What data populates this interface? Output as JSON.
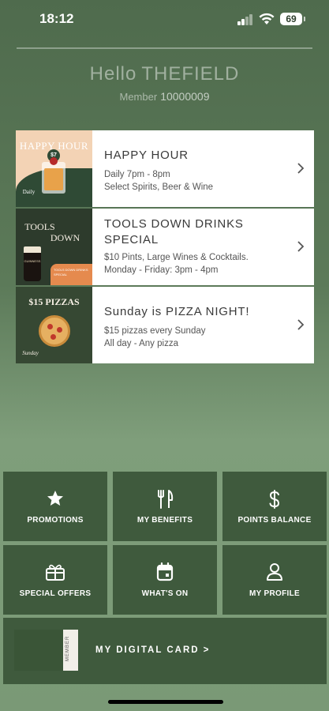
{
  "status_bar": {
    "time": "18:12",
    "battery": "69"
  },
  "header": {
    "greeting": "Hello",
    "user_name": "THEFIELD",
    "member_label": "Member",
    "member_number": "10000009"
  },
  "promotions": [
    {
      "title": "HAPPY HOUR",
      "lines": [
        "Daily 7pm - 8pm",
        "Select Spirits, Beer & Wine"
      ],
      "thumb_text": [
        "HAPPY HOUR",
        "$7",
        "Daily"
      ]
    },
    {
      "title_lines": [
        "TOOLS DOWN DRINKS",
        "SPECIAL"
      ],
      "lines": [
        "$10 Pints, Large Wines & Cocktails.",
        "Monday - Friday: 3pm - 4pm"
      ],
      "thumb_text": [
        "TOOLS",
        "DOWN",
        "GUINNESS",
        "TOOLS DOWN DRINKS SPECIAL"
      ]
    },
    {
      "title": "Sunday is PIZZA NIGHT!",
      "lines": [
        "$15 pizzas every Sunday",
        "All day - Any pizza"
      ],
      "thumb_text": [
        "$15 PIZZAS",
        "Sunday"
      ]
    }
  ],
  "menu_tiles": [
    {
      "label": "PROMOTIONS",
      "icon": "star-icon"
    },
    {
      "label": "MY BENEFITS",
      "icon": "cutlery-icon"
    },
    {
      "label": "POINTS BALANCE",
      "icon": "dollar-icon"
    },
    {
      "label": "SPECIAL OFFERS",
      "icon": "gift-icon"
    },
    {
      "label": "WHAT'S ON",
      "icon": "calendar-icon"
    },
    {
      "label": "MY PROFILE",
      "icon": "person-icon"
    }
  ],
  "digital_card": {
    "label": "MY DIGITAL CARD  >",
    "strip_text": "MEMBER"
  },
  "colors": {
    "tile": "#3f5a3d",
    "background": "#5c7a59",
    "card": "#ffffff"
  }
}
